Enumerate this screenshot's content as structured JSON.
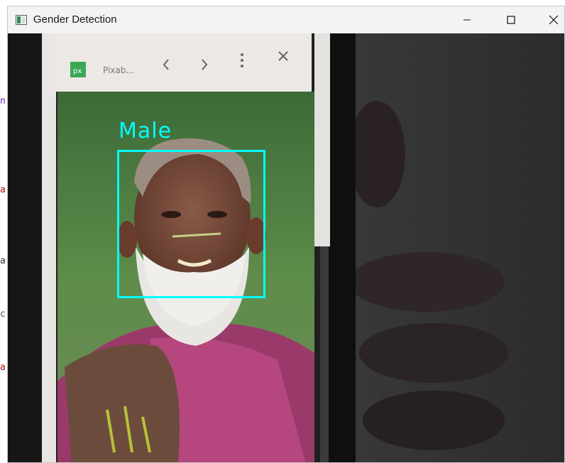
{
  "window": {
    "title": "Gender Detection"
  },
  "controls": {
    "minimize": "minimize-icon",
    "maximize": "maximize-icon",
    "close": "close-icon"
  },
  "detection": {
    "label": "Male",
    "box_color": "#00ffff"
  },
  "phone_browser": {
    "tab_label": "Pixab...",
    "tab_badge": "px"
  },
  "colors": {
    "accent": "#00ffff",
    "titlebar": "#f3f3f3"
  }
}
